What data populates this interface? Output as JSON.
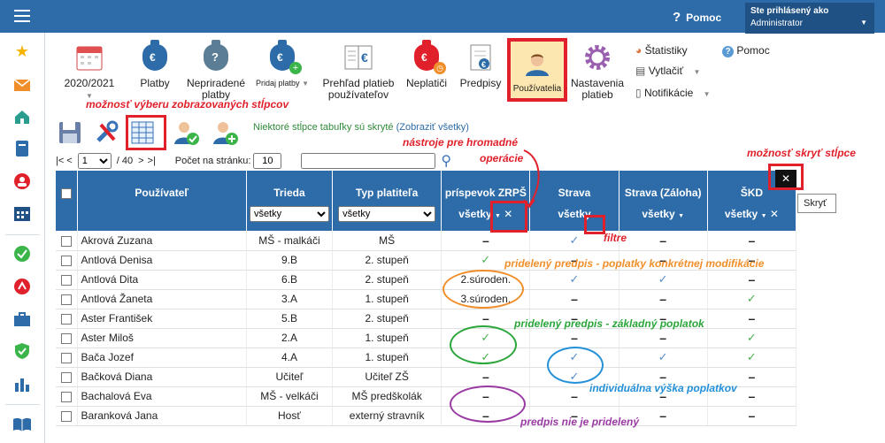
{
  "topbar": {
    "help_icon_glyph": "?",
    "help_label": "Pomoc",
    "user_line1": "Ste prihlásený ako",
    "user_line2": "Administrator"
  },
  "sidebar": {
    "icons": [
      "star-icon",
      "mail-icon",
      "home-icon",
      "notebook-icon",
      "contact-icon",
      "calendar-icon",
      "check-circle-icon",
      "alert-circle-icon",
      "briefcase-icon",
      "shield-check-icon",
      "bar-chart-icon",
      "book-icon"
    ]
  },
  "ribbon": {
    "items": [
      {
        "label": "2020/2021",
        "icon": "calendar-icon"
      },
      {
        "label": "Platby",
        "icon": "money-bag-icon"
      },
      {
        "label": "Nepriradené platby",
        "icon": "money-bag-question-icon"
      },
      {
        "label": "Pridaj platby",
        "icon": "money-bag-add-icon"
      },
      {
        "label": "Prehľad platieb používateľov",
        "icon": "book-euro-icon"
      },
      {
        "label": "Neplatiči",
        "icon": "money-bag-clock-icon"
      },
      {
        "label": "Predpisy",
        "icon": "document-euro-icon"
      },
      {
        "label": "Používatelia",
        "icon": "user-icon"
      },
      {
        "label": "Nastavenia platieb",
        "icon": "gear-icon"
      }
    ],
    "links": {
      "statistiky": "Štatistiky",
      "vytlacit": "Vytlačiť",
      "notifikacie": "Notifikácie",
      "pomoc": "Pomoc"
    }
  },
  "annotations": {
    "columns_selection": "možnosť výberu zobrazovaných stĺpcov",
    "bulk_tools_1": "nástroje pre hromadné",
    "bulk_tools_2": "operácie",
    "hide_columns": "možnosť skryť stĺpce",
    "filters": "filtre",
    "modification": "pridelený predpis - poplatky konkrétnej modifikácie",
    "basic_fee": "pridelený predpis - základný poplatok",
    "individual": "individuálna výška poplatkov",
    "not_assigned": "predpis nie je pridelený"
  },
  "toolbar": {
    "note": "Niektoré stĺpce tabuľky sú skryté",
    "note_link": "(Zobraziť všetky)"
  },
  "pager": {
    "first": "|<",
    "prev": "<",
    "page": "1",
    "total": "/ 40",
    "next": ">",
    "last": ">|",
    "per_page_label": "Počet na stránku:",
    "per_page": "10",
    "search_value": ""
  },
  "table": {
    "headers": [
      "Používateľ",
      "Trieda",
      "Typ platiteľa",
      "príspevok ZRPŠ",
      "Strava",
      "Strava (Záloha)",
      "ŠKD"
    ],
    "filter_value": "všetky",
    "close_label": "✕",
    "tooltip": "Skryť",
    "rows": [
      {
        "name": "Akrová Zuzana",
        "trieda": "MŠ - malkáči",
        "typ": "MŠ",
        "zrps": "–",
        "strava": "✓b",
        "zaloha": "–",
        "skd": "–"
      },
      {
        "name": "Antlová Denisa",
        "trieda": "9.B",
        "typ": "2. stupeň",
        "zrps": "✓",
        "strava": "–",
        "zaloha": "–",
        "skd": "–"
      },
      {
        "name": "Antlová Dita",
        "trieda": "6.B",
        "typ": "2. stupeň",
        "zrps": "2.súroden.",
        "strava": "✓b",
        "zaloha": "✓b",
        "skd": "–"
      },
      {
        "name": "Antlová Žaneta",
        "trieda": "3.A",
        "typ": "1. stupeň",
        "zrps": "3.súroden.",
        "strava": "–",
        "zaloha": "–",
        "skd": "✓"
      },
      {
        "name": "Aster František",
        "trieda": "5.B",
        "typ": "2. stupeň",
        "zrps": "–",
        "strava": "–",
        "zaloha": "–",
        "skd": "–"
      },
      {
        "name": "Aster Miloš",
        "trieda": "2.A",
        "typ": "1. stupeň",
        "zrps": "✓",
        "strava": "–",
        "zaloha": "–",
        "skd": "✓"
      },
      {
        "name": "Bača Jozef",
        "trieda": "4.A",
        "typ": "1. stupeň",
        "zrps": "✓",
        "strava": "✓b",
        "zaloha": "✓b",
        "skd": "✓"
      },
      {
        "name": "Bačková Diana",
        "trieda": "Učiteľ",
        "typ": "Učiteľ ZŠ",
        "zrps": "–",
        "strava": "✓b",
        "zaloha": "–",
        "skd": "–"
      },
      {
        "name": "Bachalová Eva",
        "trieda": "MŠ - velkáči",
        "typ": "MŠ predškolák",
        "zrps": "–",
        "strava": "–",
        "zaloha": "–",
        "skd": "–"
      },
      {
        "name": "Baranková Jana",
        "trieda": "Hosť",
        "typ": "externý stravník",
        "zrps": "–",
        "strava": "–",
        "zaloha": "–",
        "skd": "–"
      }
    ]
  },
  "colors": {
    "primary": "#2d6ca8",
    "annotation_red": "#e0212c",
    "green": "#2aa63b",
    "blue": "#2390d8",
    "orange": "#f08e2a",
    "purple": "#9a3aa3"
  }
}
